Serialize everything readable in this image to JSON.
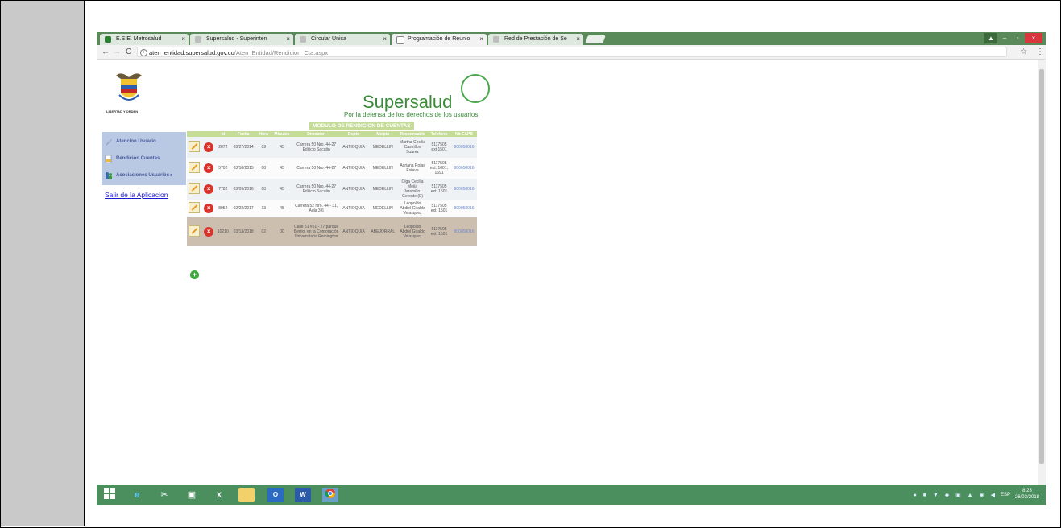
{
  "browser": {
    "tabs": [
      {
        "label": "E.S.E. Metrosalud",
        "close": "×",
        "fav_color": "#2e7d32"
      },
      {
        "label": "Supersalud - Superinten",
        "close": "×",
        "fav_color": "#bdbdbd"
      },
      {
        "label": "Circular Unica",
        "close": "×",
        "fav_color": "#bdbdbd"
      },
      {
        "label": "Programación de Reunio",
        "close": "×",
        "fav_color": "#ffffff"
      },
      {
        "label": "Red de Prestación de Se",
        "close": "×",
        "fav_color": "#bdbdbd"
      }
    ],
    "url_host": "aten_entidad.supersalud.gov.co",
    "url_path": "/Aten_Entidad/Rendicion_Cta.aspx",
    "back": "←",
    "forward": "→",
    "reload": "C",
    "star": "☆",
    "menu": "⋮",
    "win_minimize": "–",
    "win_maximize": "▫",
    "win_close": "×"
  },
  "header": {
    "coat_text": "LIBERTAD Y ORDEN",
    "brand": "Supersalud",
    "tagline": "Por la defensa de los derechos de los usuarios",
    "module_title": "MODULO DE RENDICION DE CUENTAS"
  },
  "sidebar": {
    "items": [
      {
        "label": "Atencion Usuario",
        "icon": "pencil-icon"
      },
      {
        "label": "Rendicion Cuentas",
        "icon": "document-icon"
      },
      {
        "label": "Asociaciones Usuarios ▸",
        "icon": "users-icon"
      }
    ],
    "logout": "Salir de la Aplicacion"
  },
  "table": {
    "headers": [
      "",
      "",
      "Id",
      "Fecha",
      "Hora",
      "Minutos",
      "Direccion",
      "Depto",
      "Mcipio",
      "Responsable",
      "Telefono",
      "Nit EAPB"
    ],
    "rows": [
      {
        "id": "2872",
        "fecha": "03/27/2014",
        "hora": "09",
        "min": "45",
        "dir": "Carrera 50 Nro. 44-27 Edificio Sacatin",
        "depto": "ANTIOQUIA",
        "mun": "MEDELLIN",
        "resp": "Martha Cecilia Castrillon Suarez",
        "tel": "5117505 ext:1501",
        "nit": "800058016"
      },
      {
        "id": "5702",
        "fecha": "03/18/2015",
        "hora": "08",
        "min": "45",
        "dir": "Carrera 50 Nro. 44-27",
        "depto": "ANTIOQUIA",
        "mun": "MEDELLIN",
        "resp": "Adriana Rojas Estava",
        "tel": "5117505 ext. 1601, 1691",
        "nit": "800058016"
      },
      {
        "id": "7782",
        "fecha": "03/09/2016",
        "hora": "08",
        "min": "45",
        "dir": "Carrera 50 Nro. 44-27 Edificio Sacatin",
        "depto": "ANTIOQUIA",
        "mun": "MEDELLIN",
        "resp": "Olga Cecilia Mejia Jaramillo, Gerente (E)",
        "tel": "5117505 ext. 1501",
        "nit": "800058016"
      },
      {
        "id": "8952",
        "fecha": "02/28/2017",
        "hora": "13",
        "min": "45",
        "dir": "Carrera 52 Nro. 44 - 31, Aula 3.6",
        "depto": "ANTIOQUIA",
        "mun": "MEDELLIN",
        "resp": "Leopoldo Abdiel Giraldo Velasquez",
        "tel": "5117505 ext. 1501",
        "nit": "800058016"
      },
      {
        "id": "10210",
        "fecha": "03/13/2018",
        "hora": "02",
        "min": "00",
        "dir": "Calle 51 #51 - 27 parque Berrio, en la Corporación Universitaria Remington",
        "depto": "ANTIOQUIA",
        "mun": "ABEJORRAL",
        "resp": "Leopoldo Abdiel Giraldo Velasquez",
        "tel": "5117505 ext. 1501",
        "nit": "800058016"
      }
    ]
  },
  "taskbar": {
    "items": [
      "windows-icon",
      "ie-icon",
      "snipping-icon",
      "store-icon",
      "excel-icon",
      "explorer-icon",
      "outlook-icon",
      "word-icon",
      "chrome-icon"
    ],
    "lang": "ESP",
    "time": "8:23",
    "date": "26/03/2018"
  },
  "colors": {
    "tab_bar": "#5a8a5a",
    "taskbar": "#4b8f5f",
    "header_green": "#c5db98",
    "brand_green": "#3a8a3a",
    "sidebar": "#b9c9e4"
  }
}
